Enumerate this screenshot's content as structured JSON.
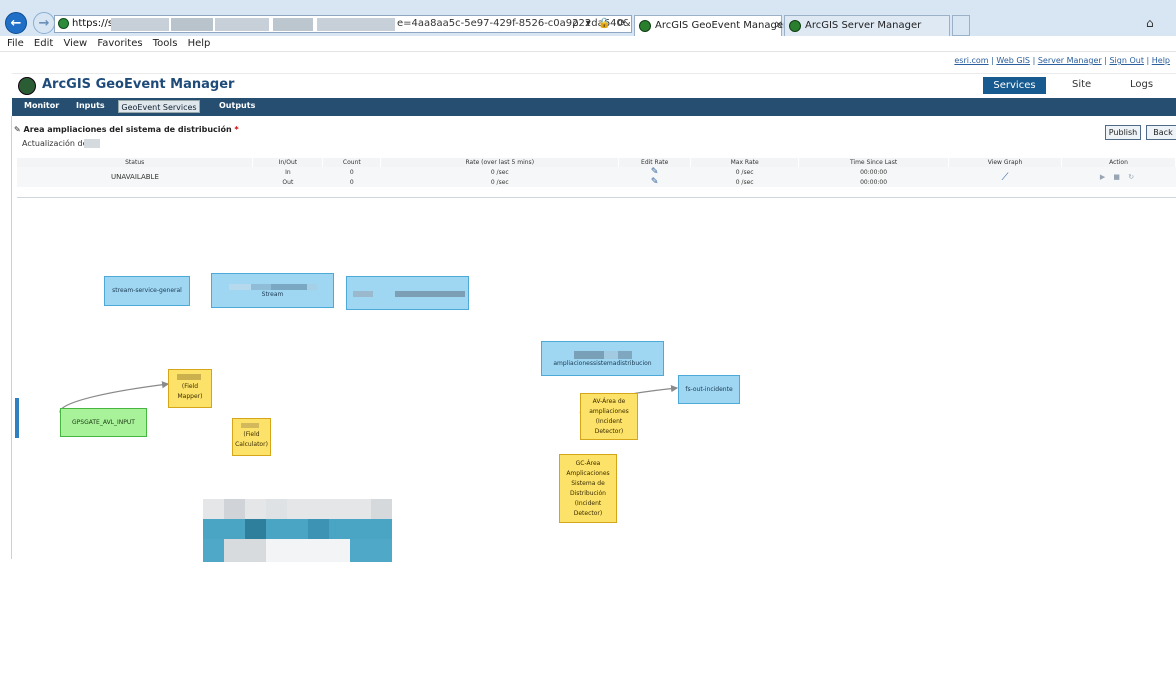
{
  "browser": {
    "url_scheme": "https://s",
    "url_rest": "e=4aa8aa5c-5e97-429f-8526-c0a9222da640&n",
    "url_tools": "ρ ▾ 🔒 ⟳",
    "tabs": [
      {
        "label": "ArcGIS GeoEvent Manager",
        "active": true
      },
      {
        "label": "ArcGIS Server Manager",
        "active": false
      }
    ],
    "menu": [
      "File",
      "Edit",
      "View",
      "Favorites",
      "Tools",
      "Help"
    ]
  },
  "top_links": {
    "items": [
      "esri.com",
      "Web GIS",
      "Server Manager",
      "Sign Out",
      "Help"
    ],
    "separator": " | "
  },
  "header": {
    "title": "ArcGIS GeoEvent Manager",
    "nav": [
      "Services",
      "Site",
      "Logs"
    ],
    "active_nav": "Services"
  },
  "subnav": {
    "items": [
      "Monitor",
      "Inputs",
      "GeoEvent Services",
      "Outputs"
    ],
    "active": "GeoEvent Services"
  },
  "service": {
    "title": "Area ampliaciones del sistema de distribución",
    "required_marker": "*",
    "description": "Actualización de '",
    "buttons": {
      "publish": "Publish",
      "back": "Back"
    }
  },
  "table": {
    "headers": [
      "Status",
      "In/Out",
      "Count",
      "Rate (over last 5 mins)",
      "Edit Rate",
      "Max Rate",
      "Time Since Last",
      "View Graph",
      "Action"
    ],
    "status": "UNAVAILABLE",
    "rows": [
      {
        "inout": "In",
        "count": "0",
        "rate": "0 /sec",
        "max_rate": "0 /sec",
        "time_since": "00:00:00"
      },
      {
        "inout": "Out",
        "count": "0",
        "rate": "0 /sec",
        "max_rate": "0 /sec",
        "time_since": "00:00:00"
      }
    ],
    "action_icons": "▶ ■ ↻"
  },
  "canvas": {
    "nodes": {
      "stream_general": "stream-service-general",
      "stream": "Stream",
      "ampliaciones": "ampliacionessistemadistribucion",
      "fs_out": "fs-out-incidente",
      "field_mapper": "(Field Mapper)",
      "field_calculator": "(Field Calculator)",
      "gpsgate": "GPSGATE_AVL_INPUT",
      "av_area": "AV-Área de ampliaciones (Incident Detector)",
      "gc_area": "GC-Área Amplicaciones Sistema de Distribución (Incident Detector)"
    }
  },
  "colors": {
    "nav_dark": "#254e71",
    "services_active": "#175a8f",
    "node_blue": "#9fd6f2",
    "node_yellow": "#fde26a",
    "node_green": "#a8f29a"
  }
}
